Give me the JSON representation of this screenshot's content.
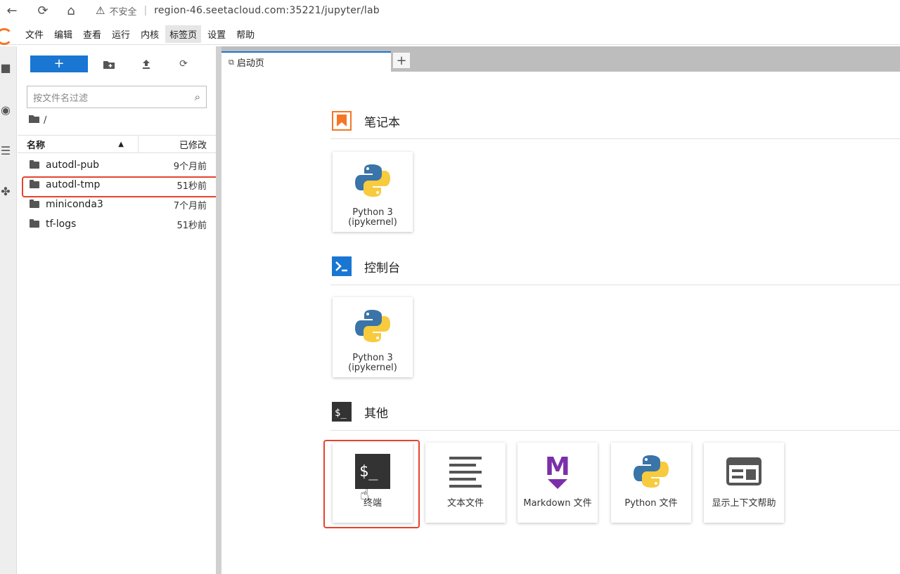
{
  "browser": {
    "warning": "不安全",
    "url": "region-46.seetacloud.com:35221/jupyter/lab"
  },
  "menu": [
    "文件",
    "编辑",
    "查看",
    "运行",
    "内核",
    "标签页",
    "设置",
    "帮助"
  ],
  "filebrowser": {
    "new_label": "+",
    "filter_placeholder": "按文件名过滤",
    "breadcrumb": "/",
    "col_name": "名称",
    "col_modified": "已修改",
    "files": [
      {
        "name": "autodl-pub",
        "modified": "9个月前"
      },
      {
        "name": "autodl-tmp",
        "modified": "51秒前"
      },
      {
        "name": "miniconda3",
        "modified": "7个月前"
      },
      {
        "name": "tf-logs",
        "modified": "51秒前"
      }
    ]
  },
  "tab": {
    "label": "启动页",
    "add": "+"
  },
  "launcher": {
    "notebook": {
      "title": "笔记本",
      "cards": [
        {
          "label": "Python 3 (ipykernel)"
        }
      ]
    },
    "console": {
      "title": "控制台",
      "cards": [
        {
          "label": "Python 3 (ipykernel)"
        }
      ]
    },
    "other": {
      "title": "其他",
      "cards": [
        {
          "label": "终端",
          "icon": "terminal-icon"
        },
        {
          "label": "文本文件",
          "icon": "text-file-icon"
        },
        {
          "label": "Markdown 文件",
          "icon": "markdown-icon"
        },
        {
          "label": "Python 文件",
          "icon": "python-icon"
        },
        {
          "label": "显示上下文帮助",
          "icon": "context-help-icon"
        }
      ]
    }
  },
  "colors": {
    "accent": "#1976d2",
    "highlight": "#e5432d",
    "jupyter_orange": "#f37726",
    "markdown_purple": "#7b2fa9"
  }
}
